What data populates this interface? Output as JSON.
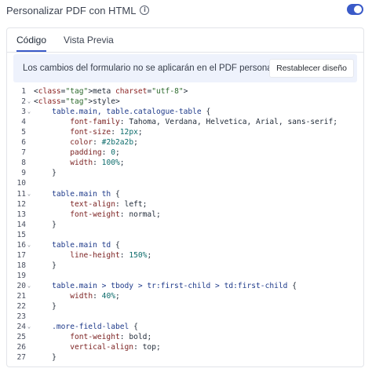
{
  "header": {
    "title": "Personalizar PDF con HTML",
    "info_icon": "info-icon",
    "toggle_on": true,
    "accent_color": "#3a5ac8"
  },
  "tabs": [
    {
      "label": "Código",
      "active": true
    },
    {
      "label": "Vista Previa",
      "active": false
    }
  ],
  "notice": {
    "text": "Los cambios del formulario no se aplicarán en el PDF personalizado",
    "button_label": "Restablecer diseño"
  },
  "code_lines": [
    {
      "n": "1",
      "fold": false,
      "text": "<meta charset=\"utf-8\">"
    },
    {
      "n": "2",
      "fold": true,
      "text": "<style>"
    },
    {
      "n": "3",
      "fold": true,
      "text": "    table.main, table.catalogue-table {"
    },
    {
      "n": "4",
      "fold": false,
      "text": "        font-family: Tahoma, Verdana, Helvetica, Arial, sans-serif;"
    },
    {
      "n": "5",
      "fold": false,
      "text": "        font-size: 12px;"
    },
    {
      "n": "6",
      "fold": false,
      "text": "        color: #2b2a2b;"
    },
    {
      "n": "7",
      "fold": false,
      "text": "        padding: 0;"
    },
    {
      "n": "8",
      "fold": false,
      "text": "        width: 100%;"
    },
    {
      "n": "9",
      "fold": false,
      "text": "    }"
    },
    {
      "n": "10",
      "fold": false,
      "text": ""
    },
    {
      "n": "11",
      "fold": true,
      "text": "    table.main th {"
    },
    {
      "n": "12",
      "fold": false,
      "text": "        text-align: left;"
    },
    {
      "n": "13",
      "fold": false,
      "text": "        font-weight: normal;"
    },
    {
      "n": "14",
      "fold": false,
      "text": "    }"
    },
    {
      "n": "15",
      "fold": false,
      "text": ""
    },
    {
      "n": "16",
      "fold": true,
      "text": "    table.main td {"
    },
    {
      "n": "17",
      "fold": false,
      "text": "        line-height: 150%;"
    },
    {
      "n": "18",
      "fold": false,
      "text": "    }"
    },
    {
      "n": "19",
      "fold": false,
      "text": ""
    },
    {
      "n": "20",
      "fold": true,
      "text": "    table.main > tbody > tr:first-child > td:first-child {"
    },
    {
      "n": "21",
      "fold": false,
      "text": "        width: 40%;"
    },
    {
      "n": "22",
      "fold": false,
      "text": "    }"
    },
    {
      "n": "23",
      "fold": false,
      "text": ""
    },
    {
      "n": "24",
      "fold": true,
      "text": "    .more-field-label {"
    },
    {
      "n": "25",
      "fold": false,
      "text": "        font-weight: bold;"
    },
    {
      "n": "26",
      "fold": false,
      "text": "        vertical-align: top;"
    },
    {
      "n": "27",
      "fold": false,
      "text": "    }"
    }
  ]
}
